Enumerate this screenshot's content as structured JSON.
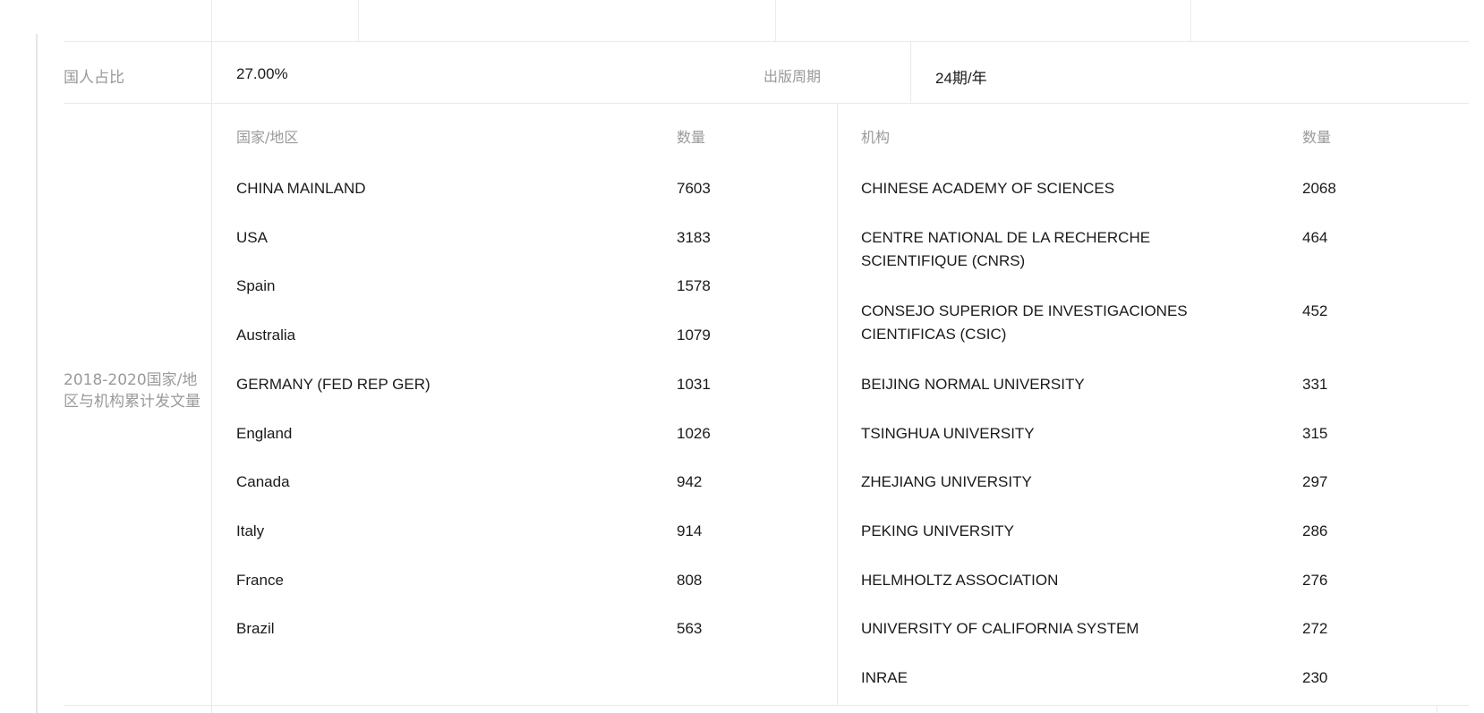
{
  "summary": {
    "domestic_share_label": "国人占比",
    "domestic_share_value": "27.00%",
    "frequency_label": "出版周期",
    "frequency_value": "24期/年"
  },
  "stats": {
    "row_label": "2018-2020国家/地区与机构累计发文量",
    "countries": {
      "header_name": "国家/地区",
      "header_count": "数量",
      "rows": [
        {
          "name": "CHINA MAINLAND",
          "count": "7603"
        },
        {
          "name": "USA",
          "count": "3183"
        },
        {
          "name": "Spain",
          "count": "1578"
        },
        {
          "name": "Australia",
          "count": "1079"
        },
        {
          "name": "GERMANY (FED REP GER)",
          "count": "1031"
        },
        {
          "name": "England",
          "count": "1026"
        },
        {
          "name": "Canada",
          "count": "942"
        },
        {
          "name": "Italy",
          "count": "914"
        },
        {
          "name": "France",
          "count": "808"
        },
        {
          "name": "Brazil",
          "count": "563"
        }
      ]
    },
    "institutions": {
      "header_name": "机构",
      "header_count": "数量",
      "rows": [
        {
          "name": "CHINESE ACADEMY OF SCIENCES",
          "count": "2068"
        },
        {
          "name": "CENTRE NATIONAL DE LA RECHERCHE SCIENTIFIQUE (CNRS)",
          "count": "464"
        },
        {
          "name": "CONSEJO SUPERIOR DE INVESTIGACIONES CIENTIFICAS (CSIC)",
          "count": "452"
        },
        {
          "name": "BEIJING NORMAL UNIVERSITY",
          "count": "331"
        },
        {
          "name": "TSINGHUA UNIVERSITY",
          "count": "315"
        },
        {
          "name": "ZHEJIANG UNIVERSITY",
          "count": "297"
        },
        {
          "name": "PEKING UNIVERSITY",
          "count": "286"
        },
        {
          "name": "HELMHOLTZ ASSOCIATION",
          "count": "276"
        },
        {
          "name": "UNIVERSITY OF CALIFORNIA SYSTEM",
          "count": "272"
        },
        {
          "name": "INRAE",
          "count": "230"
        }
      ]
    }
  }
}
